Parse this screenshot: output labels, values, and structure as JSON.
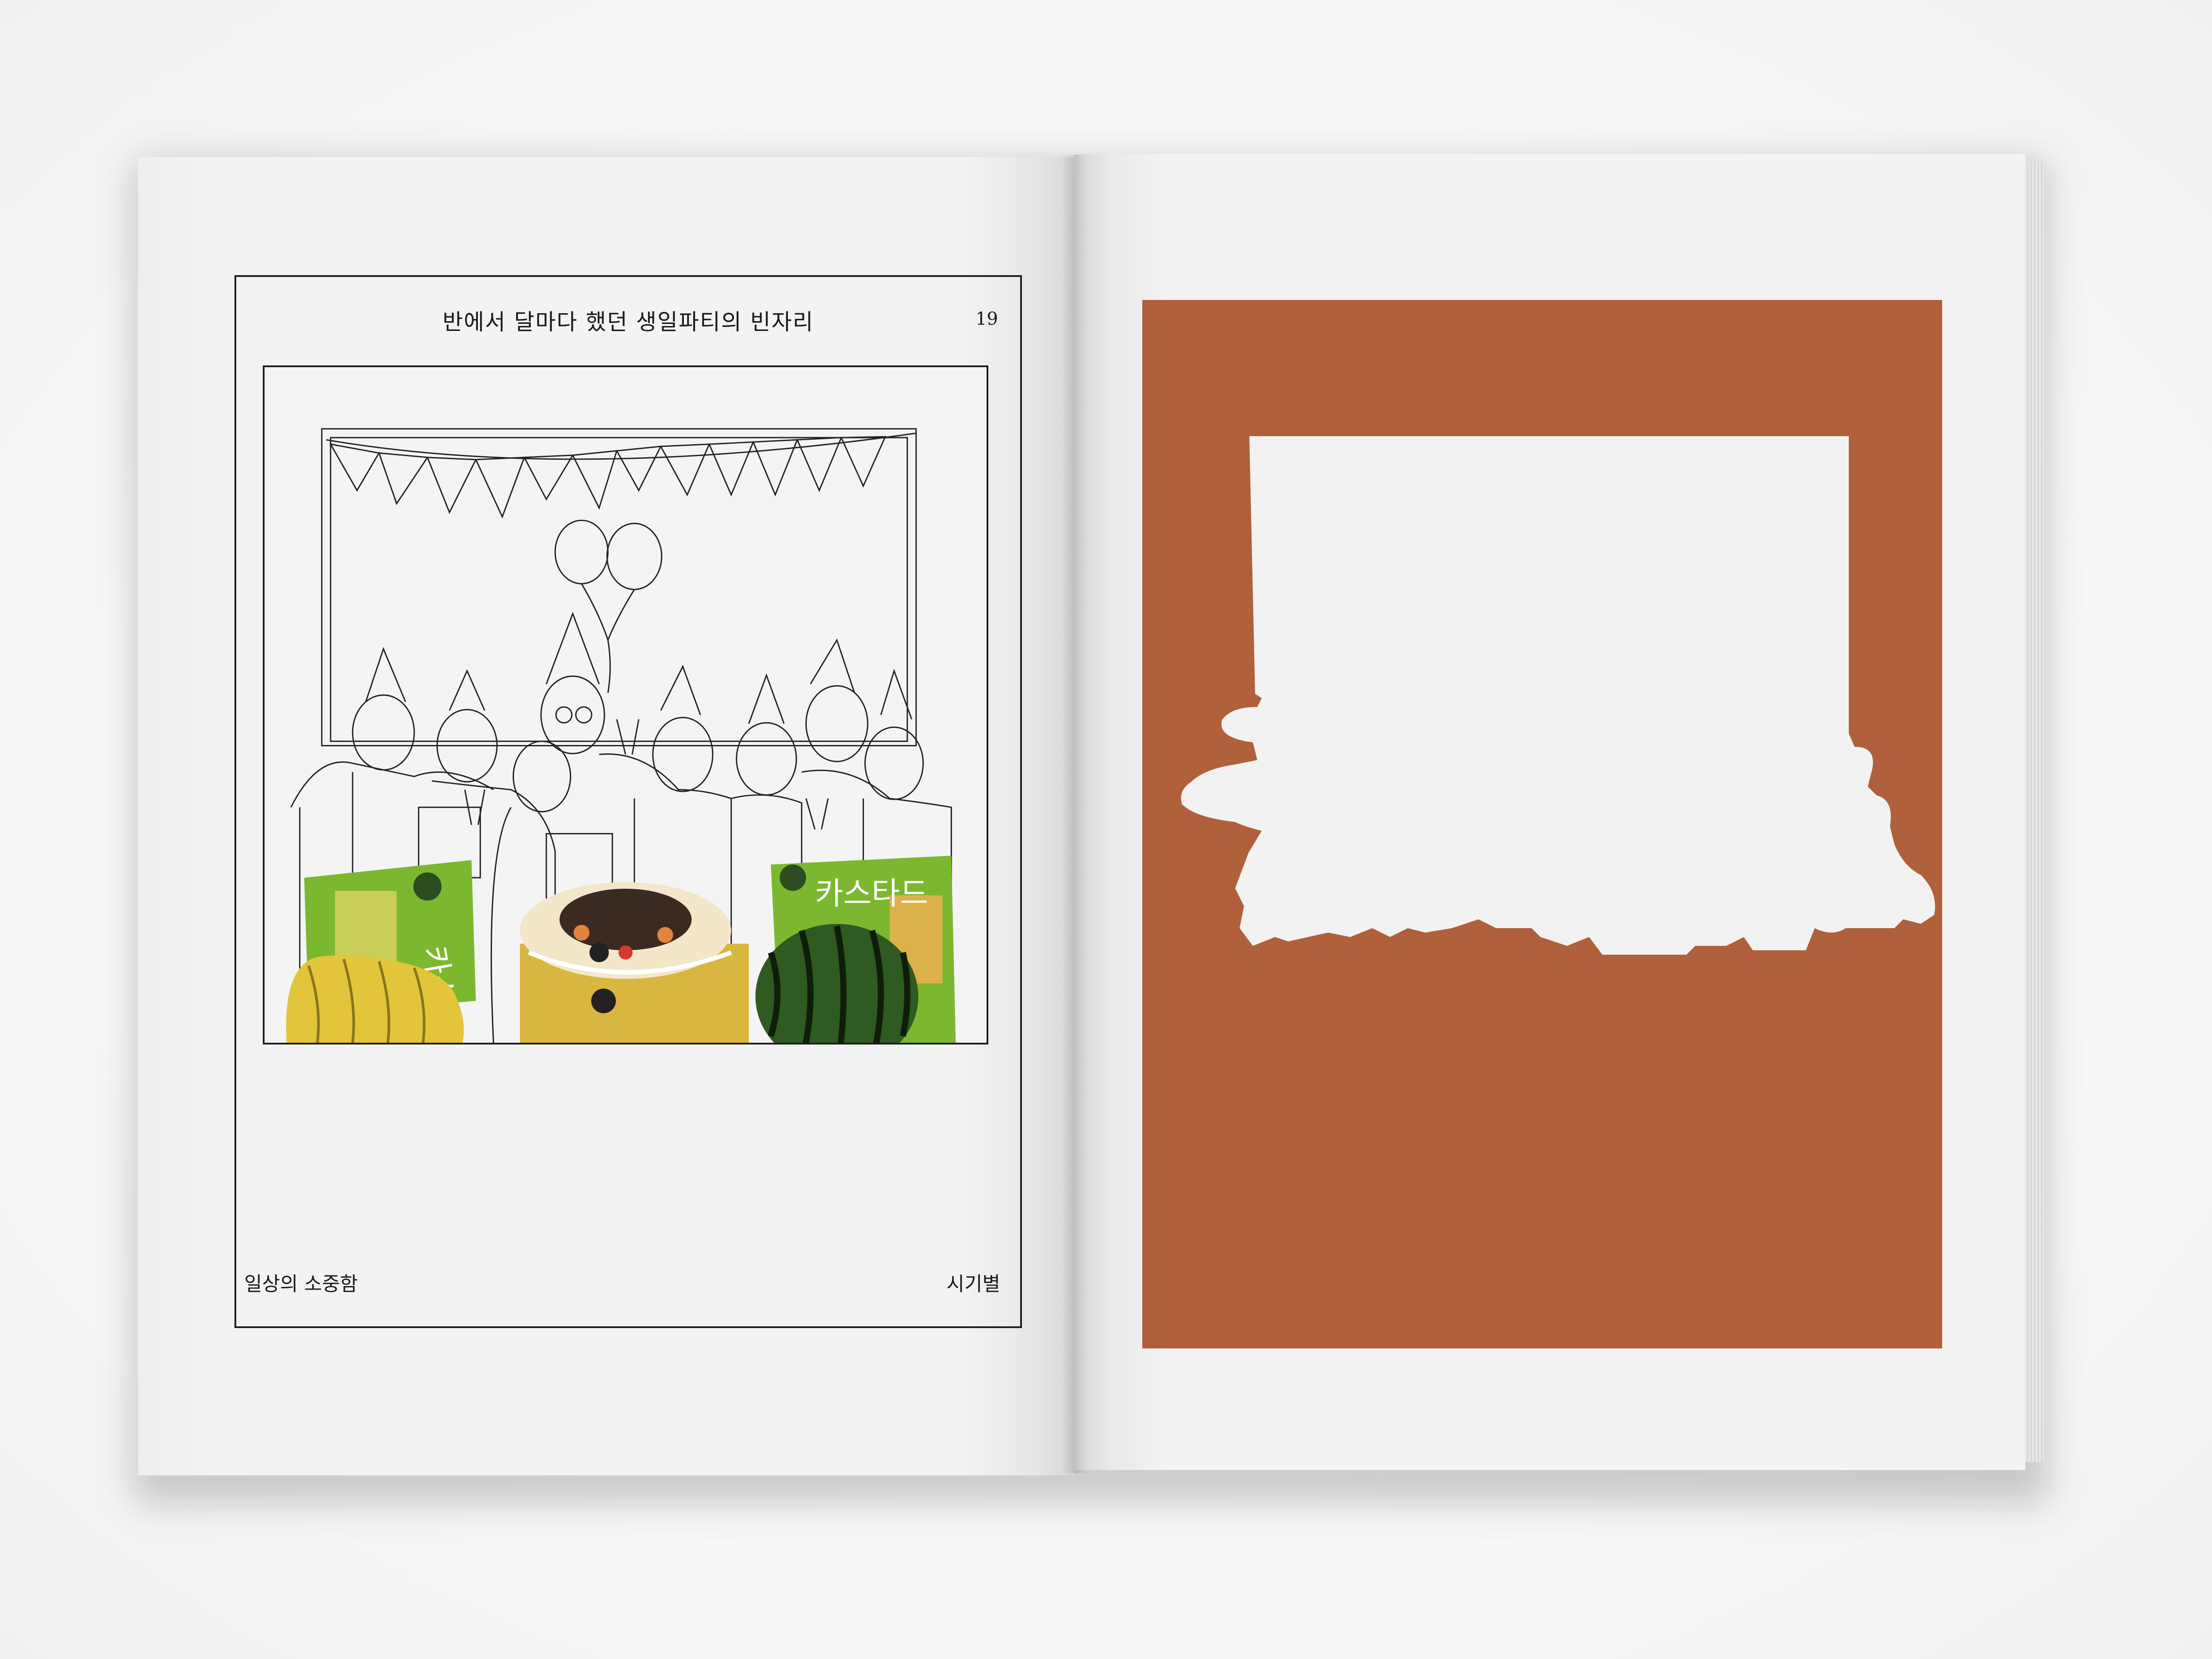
{
  "left_page": {
    "title": "반에서 달마다 했던 생일파티의 빈자리",
    "page_number": "19",
    "footer_left": "일상의 소중함",
    "footer_right": "시기별",
    "illustration": {
      "description_icons": [
        "bunting-icon",
        "balloon-icon",
        "party-hat-icon",
        "banana-icon",
        "cake-icon",
        "watermelon-icon",
        "snack-bag-icon"
      ]
    }
  },
  "right_page": {
    "panel_color": "#b0603b",
    "cutout_color": "#f2f2f2"
  },
  "colors": {
    "page": "#f2f2f2",
    "line": "#1e1e1e",
    "accent_orange": "#b0603b",
    "snack_green": "#7cb82f",
    "banana_yellow": "#e2c53a",
    "watermelon_green": "#2f5a22"
  }
}
